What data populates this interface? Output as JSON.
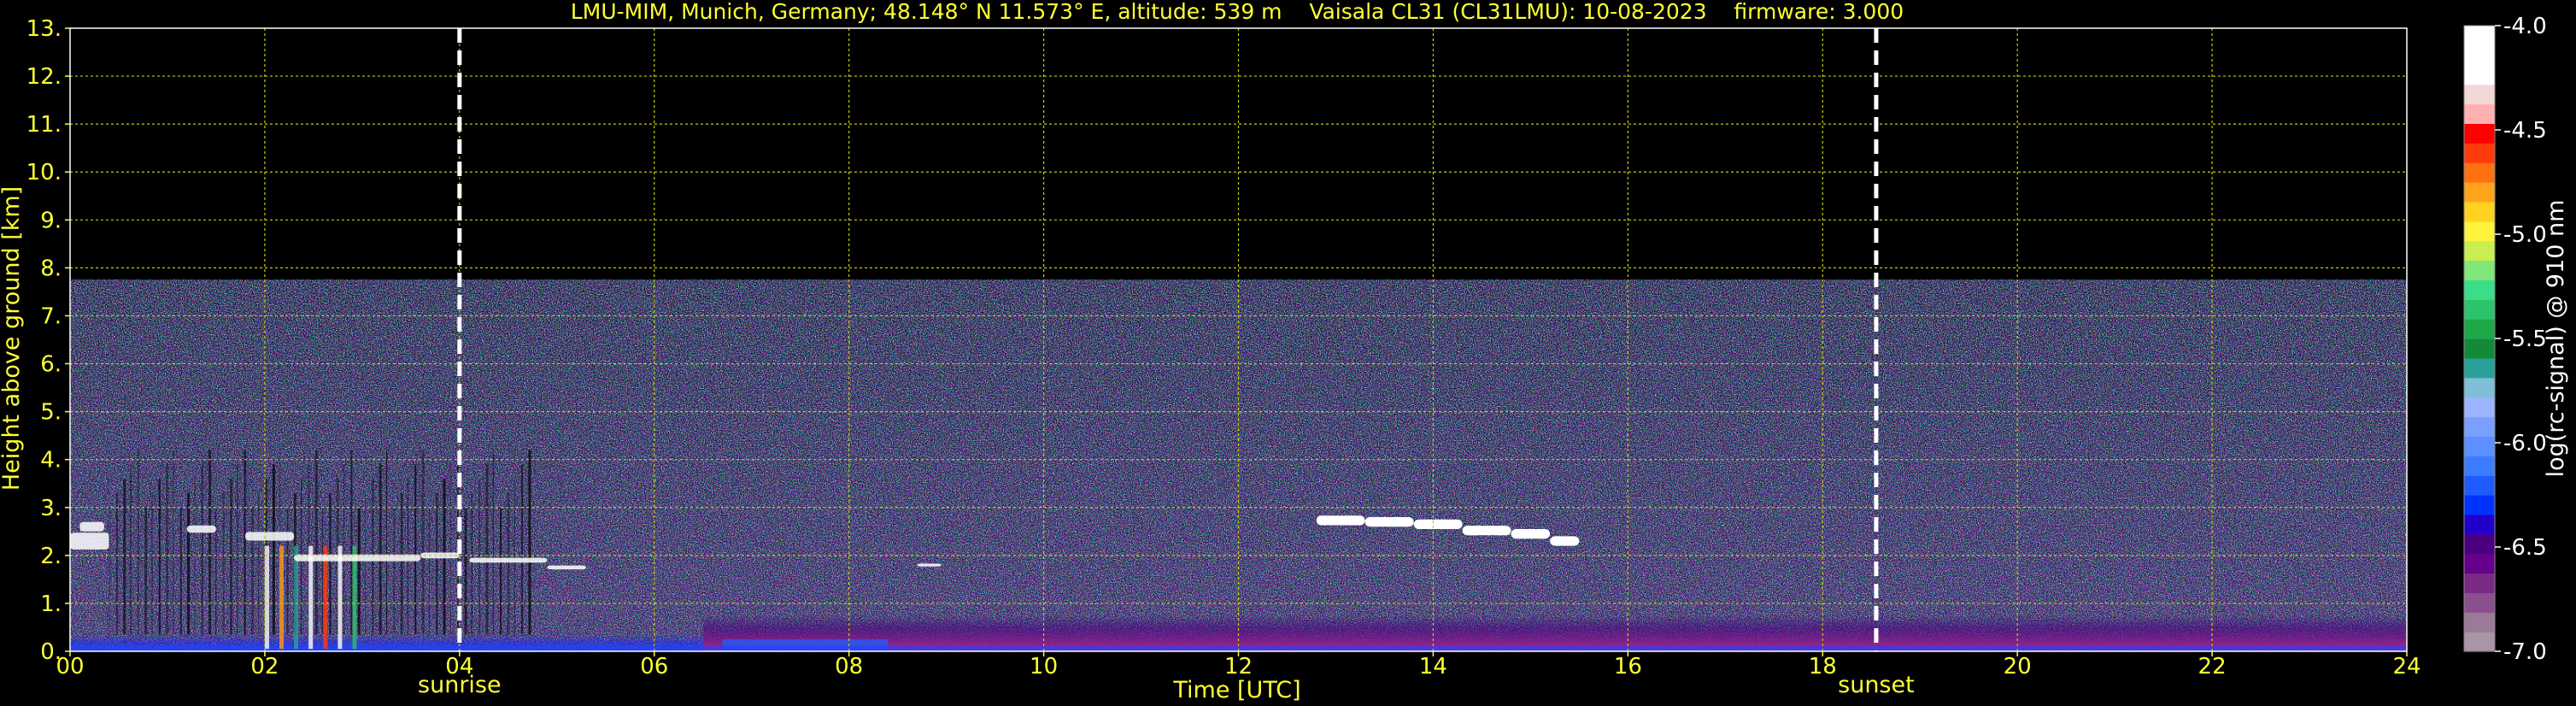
{
  "chart_data": {
    "type": "heatmap",
    "title": "LMU-MIM, Munich, Germany; 48.148° N 11.573° E, altitude: 539 m    Vaisala CL31 (CL31LMU): 10-08-2023    firmware: 3.000",
    "xlabel": "Time [UTC]",
    "ylabel": "Height above ground [km]",
    "xlim": [
      0,
      24
    ],
    "ylim": [
      0,
      13
    ],
    "x_ticks": [
      "00",
      "02",
      "04",
      "06",
      "08",
      "10",
      "12",
      "14",
      "16",
      "18",
      "20",
      "22",
      "24"
    ],
    "y_ticks": [
      "0.",
      "1.",
      "2.",
      "3.",
      "4.",
      "5.",
      "6.",
      "7.",
      "8.",
      "9.",
      "10.",
      "11.",
      "12.",
      "13."
    ],
    "grid": true,
    "grid_color": "#cccc00",
    "background_color": "#000000",
    "data_top_km": 7.75,
    "events": [
      {
        "label": "sunrise",
        "time_h": 4.0
      },
      {
        "label": "sunset",
        "time_h": 18.55
      }
    ],
    "features": [
      {
        "label": "",
        "description": "elevated cloud layer",
        "time_start_h": 12.8,
        "time_end_h": 15.5,
        "height_km": 2.6
      },
      {
        "label": "",
        "description": "boundary layer clouds",
        "time_start_h": 0.0,
        "time_end_h": 5.3,
        "height_km": 1.9
      },
      {
        "label": "",
        "description": "dense aerosol layer near ground",
        "time_start_h": 7.0,
        "time_end_h": 24.0,
        "height_km": 0.4
      }
    ],
    "colorbar": {
      "label": "log(rc-signal) @ 910 nm",
      "range": [
        -7.0,
        -4.0
      ],
      "ticks": [
        "-4.0",
        "-4.5",
        "-5.0",
        "-5.5",
        "-6.0",
        "-6.5",
        "-7.0"
      ],
      "colors": [
        "#a895a6",
        "#9a7a98",
        "#8a4f8c",
        "#7a2a84",
        "#66008a",
        "#4b0082",
        "#2200cc",
        "#0033ff",
        "#1f5cff",
        "#3d7cff",
        "#5c8fff",
        "#7aa0ff",
        "#9bb4ff",
        "#7fbfd6",
        "#2aa198",
        "#138a3a",
        "#1fa84a",
        "#2cc46a",
        "#39dd8a",
        "#7fe67a",
        "#c8ee50",
        "#fff23a",
        "#ffd21f",
        "#ffa41a",
        "#ff7013",
        "#ff3a0b",
        "#ff0000",
        "#ffb0b0",
        "#f2d7d7",
        "#ffffff",
        "#ffffff",
        "#ffffff"
      ]
    }
  }
}
